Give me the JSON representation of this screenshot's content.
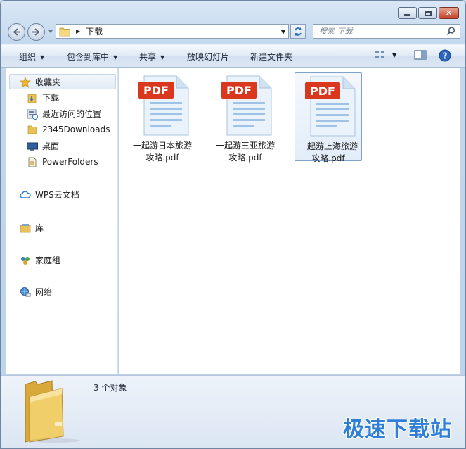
{
  "window": {
    "address": {
      "current_folder": "下载"
    },
    "search": {
      "placeholder": "搜索 下载"
    }
  },
  "toolbar": {
    "organize": "组织",
    "include_in_library": "包含到库中",
    "share": "共享",
    "slideshow": "放映幻灯片",
    "new_folder": "新建文件夹"
  },
  "navpane": {
    "favorites": "收藏夹",
    "fav_items": [
      "下载",
      "最近访问的位置",
      "2345Downloads",
      "桌面",
      "PowerFolders"
    ],
    "wps_cloud": "WPS云文档",
    "library": "库",
    "homegroup": "家庭组",
    "network": "网络"
  },
  "files": [
    {
      "line1": "一起游日本旅游",
      "line2": "攻略.pdf",
      "badge": "PDF",
      "selected": false
    },
    {
      "line1": "一起游三亚旅游",
      "line2": "攻略.pdf",
      "badge": "PDF",
      "selected": false
    },
    {
      "line1": "一起游上海旅游",
      "line2": "攻略.pdf",
      "badge": "PDF",
      "selected": true
    }
  ],
  "details": {
    "item_count": "3 个对象"
  },
  "watermark": "极速下载站",
  "colors": {
    "pdf_red": "#d9381e",
    "accent_blue": "#2f7fd6",
    "selection": "#7da2ce"
  }
}
